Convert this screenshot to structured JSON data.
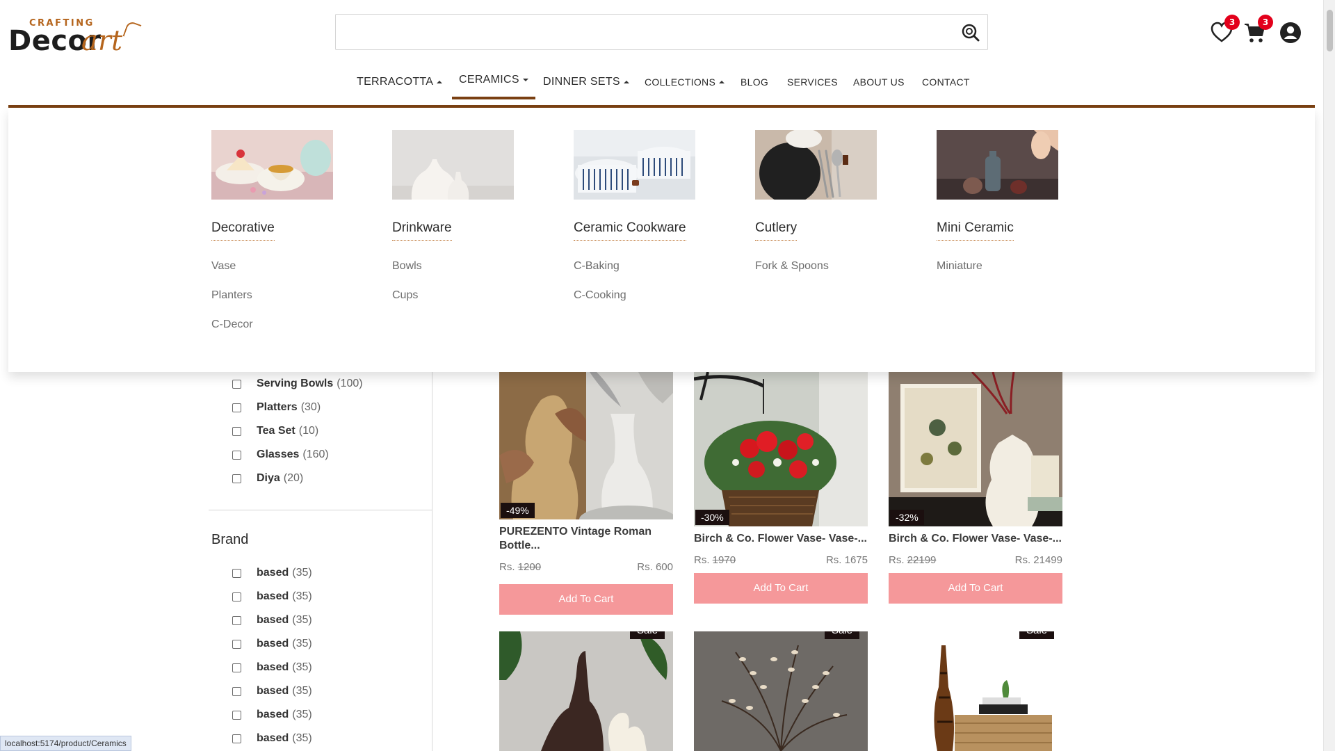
{
  "logo": {
    "top": "CRAFTING",
    "main": "Decor",
    "accent": "art"
  },
  "search": {
    "placeholder": "",
    "value": ""
  },
  "header": {
    "wishlist_count": "3",
    "cart_count": "3"
  },
  "nav": [
    {
      "label": "TERRACOTTA",
      "caret": "up"
    },
    {
      "label": "CERAMICS",
      "caret": "down",
      "active": true
    },
    {
      "label": "DINNER SETS",
      "caret": "up"
    },
    {
      "label": "COLLECTIONS",
      "caret": "up"
    },
    {
      "label": "BLOG"
    },
    {
      "label": "SERVICES"
    },
    {
      "label": "ABOUT US"
    },
    {
      "label": "CONTACT"
    }
  ],
  "mega_menu": [
    {
      "title": "Decorative",
      "links": [
        "Vase",
        "Planters",
        "C-Decor"
      ]
    },
    {
      "title": "Drinkware",
      "links": [
        "Bowls",
        "Cups"
      ]
    },
    {
      "title": "Ceramic Cookware",
      "links": [
        "C-Baking",
        "C-Cooking"
      ]
    },
    {
      "title": "Cutlery",
      "links": [
        "Fork & Spoons"
      ]
    },
    {
      "title": "Mini Ceramic",
      "links": [
        "Miniature"
      ]
    }
  ],
  "category_filters": [
    {
      "name": "Serving Bowls",
      "count": "(100)"
    },
    {
      "name": "Platters",
      "count": "(30)"
    },
    {
      "name": "Tea Set",
      "count": "(10)"
    },
    {
      "name": "Glasses",
      "count": "(160)"
    },
    {
      "name": "Diya",
      "count": "(20)"
    }
  ],
  "brand": {
    "title": "Brand",
    "items": [
      {
        "name": "based",
        "count": "(35)"
      },
      {
        "name": "based",
        "count": "(35)"
      },
      {
        "name": "based",
        "count": "(35)"
      },
      {
        "name": "based",
        "count": "(35)"
      },
      {
        "name": "based",
        "count": "(35)"
      },
      {
        "name": "based",
        "count": "(35)"
      },
      {
        "name": "based",
        "count": "(35)"
      },
      {
        "name": "based",
        "count": "(35)"
      }
    ]
  },
  "products": [
    {
      "title": "PUREZENTO Vintage Roman Bottle...",
      "discount": "-49%",
      "currency": "Rs.",
      "old_price": "1200",
      "price": "Rs. 600",
      "button": "Add To Cart"
    },
    {
      "title": "Birch & Co. Flower Vase- Vase-...",
      "discount": "-30%",
      "currency": "Rs.",
      "old_price": "1970",
      "price": "Rs. 1675",
      "button": "Add To Cart"
    },
    {
      "title": "Birch & Co. Flower Vase- Vase-...",
      "discount": "-32%",
      "currency": "Rs.",
      "old_price": "22199",
      "price": "Rs. 21499",
      "button": "Add To Cart"
    }
  ],
  "sale_label": "Sale",
  "status_url": "localhost:5174/product/Ceramics"
}
